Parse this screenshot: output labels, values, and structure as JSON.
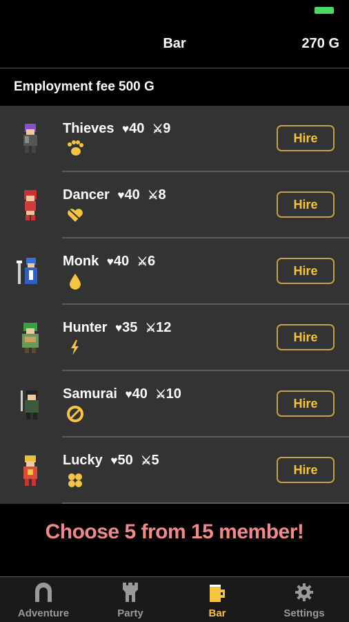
{
  "header": {
    "title": "Bar",
    "gold": "270 G"
  },
  "fee": {
    "label": "Employment fee 500 G"
  },
  "members": [
    {
      "name": "Thieves",
      "hp": "40",
      "atk": "9",
      "skill_icon": "paw-icon",
      "hire_label": "Hire"
    },
    {
      "name": "Dancer",
      "hp": "40",
      "atk": "8",
      "skill_icon": "heart-arrow-icon",
      "hire_label": "Hire"
    },
    {
      "name": "Monk",
      "hp": "40",
      "atk": "6",
      "skill_icon": "droplet-icon",
      "hire_label": "Hire"
    },
    {
      "name": "Hunter",
      "hp": "35",
      "atk": "12",
      "skill_icon": "lightning-icon",
      "hire_label": "Hire"
    },
    {
      "name": "Samurai",
      "hp": "40",
      "atk": "10",
      "skill_icon": "slash-circle-icon",
      "hire_label": "Hire"
    },
    {
      "name": "Lucky",
      "hp": "50",
      "atk": "5",
      "skill_icon": "clover-icon",
      "hire_label": "Hire"
    }
  ],
  "promo": {
    "text": "Choose 5 from 15 member!"
  },
  "tabs": [
    {
      "label": "Adventure",
      "icon": "gate-icon"
    },
    {
      "label": "Party",
      "icon": "tower-icon"
    },
    {
      "label": "Bar",
      "icon": "mug-icon",
      "active": true
    },
    {
      "label": "Settings",
      "icon": "gear-icon"
    }
  ],
  "colors": {
    "accent": "#f5c542",
    "list_bg": "#333333",
    "promo_text": "#f08a8a",
    "battery": "#4cd964"
  },
  "stat_icons": {
    "hp": "heart-icon",
    "atk": "sword-icon"
  }
}
